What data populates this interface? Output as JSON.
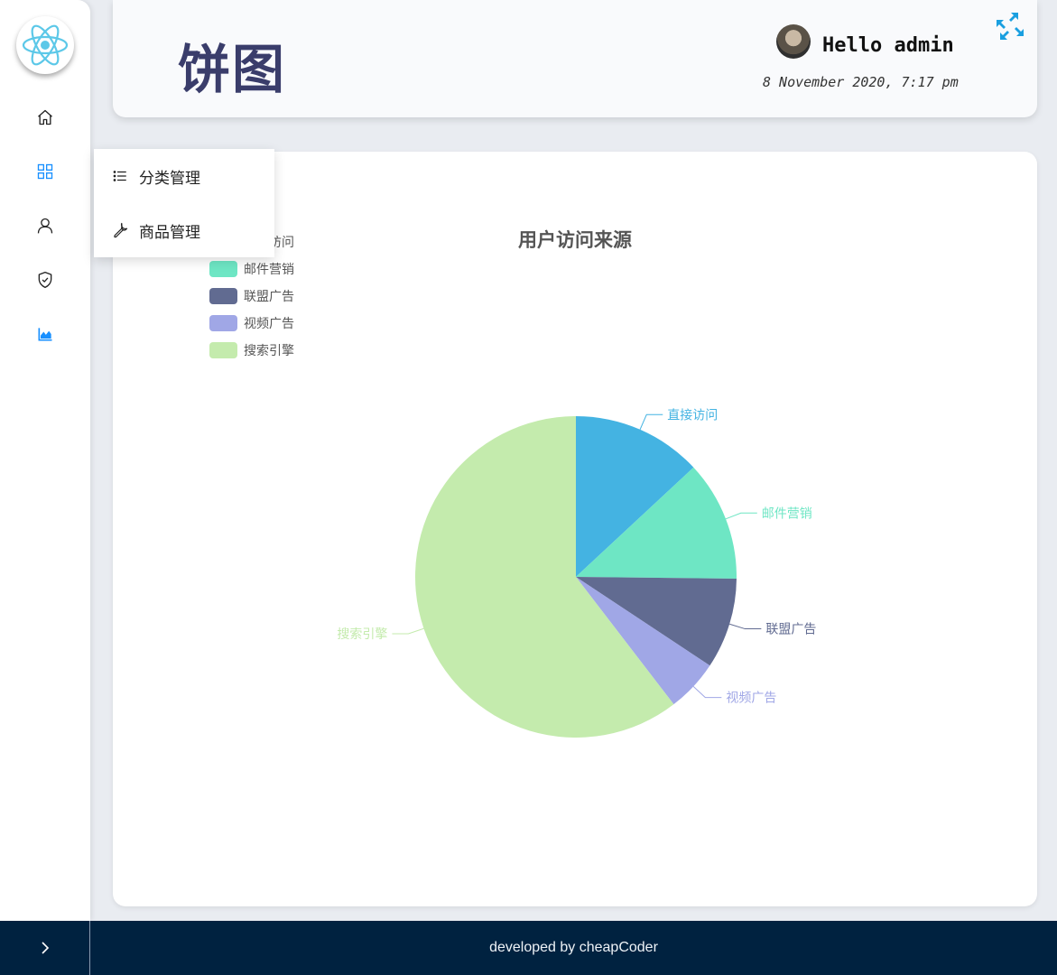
{
  "sidebar": {
    "logo": "react-logo-icon",
    "items": [
      {
        "icon": "home-icon"
      },
      {
        "icon": "grid-icon",
        "active": true
      },
      {
        "icon": "user-icon"
      },
      {
        "icon": "shield-check-icon"
      },
      {
        "icon": "area-chart-icon",
        "active": true
      }
    ]
  },
  "submenu": {
    "items": [
      {
        "icon": "list-icon",
        "label": "分类管理"
      },
      {
        "icon": "wrench-icon",
        "label": "商品管理"
      }
    ]
  },
  "header": {
    "title": "饼图",
    "greeting": "Hello admin",
    "date": "8 November 2020, 7:17 pm",
    "fullscreen_icon": "expand-arrows-icon"
  },
  "colors": {
    "accent": "#1890ff",
    "title": "#3a3d6b",
    "footer_bg": "#002240"
  },
  "chart_data": {
    "type": "pie",
    "title": "用户访问来源",
    "legend_position": "top-left",
    "categories": [
      "直接访问",
      "邮件营销",
      "联盟广告",
      "视频广告",
      "搜索引擎"
    ],
    "values": [
      335,
      310,
      234,
      135,
      1548
    ],
    "colors": [
      "#44b3e2",
      "#6ee6c4",
      "#616b91",
      "#a0a7e6",
      "#c4ebad"
    ]
  },
  "footer": {
    "text": "developed by cheapCoder",
    "toggle_icon": "chevron-right-icon"
  }
}
